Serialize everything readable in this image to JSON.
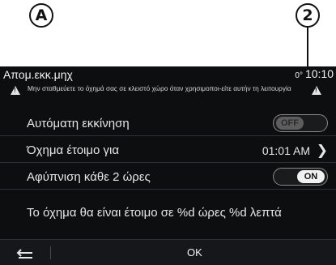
{
  "callouts": {
    "a": "A",
    "two": "2"
  },
  "header": {
    "title": "Απομ.εκκ.μηχ",
    "temperature": "0°",
    "time": "10:10"
  },
  "warning": {
    "text": "Μην σταθμεύετε το όχημά σας σε κλειστό χώρο όταν χρησιμοποι-είτε αυτήν τη λειτουργία"
  },
  "settings": {
    "auto_start": {
      "label": "Αυτόματη εκκίνηση",
      "toggle": "OFF"
    },
    "ready_for": {
      "label": "Όχημα έτοιμο για",
      "value": "01:01 AM"
    },
    "wakeup": {
      "label": "Αφύπνιση κάθε 2 ώρες",
      "toggle": "ON"
    }
  },
  "message": "Το όχημα θα είναι έτοιμο σε %d ώρες %d λεπτά",
  "footer": {
    "ok_label": "OK",
    "back_icon": "back-arrow-icon"
  }
}
